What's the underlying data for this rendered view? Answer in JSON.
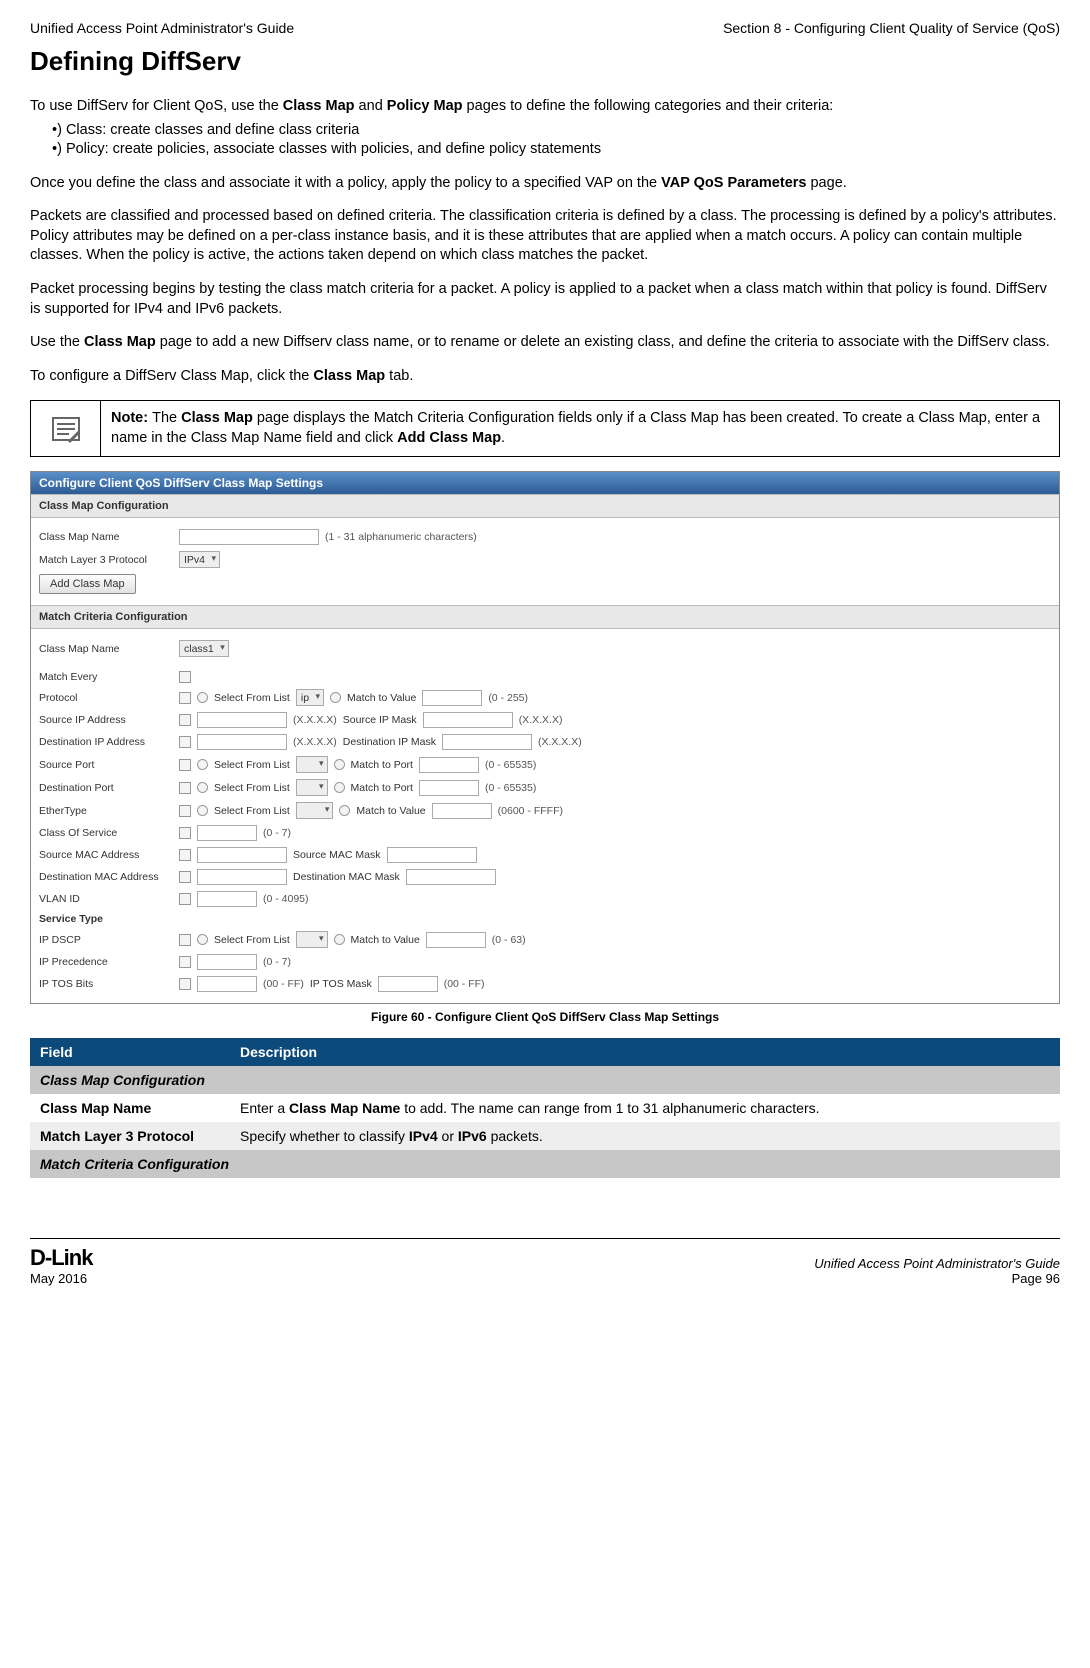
{
  "header": {
    "left": "Unified Access Point Administrator's Guide",
    "right": "Section 8 - Configuring Client Quality of Service (QoS)"
  },
  "title": "Defining DiffServ",
  "paragraphs": {
    "p1a": "To use DiffServ for Client QoS, use the ",
    "p1b": "Class Map",
    "p1c": " and ",
    "p1d": "Policy Map",
    "p1e": " pages to define the following categories and their criteria:",
    "bullet1": "Class: create classes and define class criteria",
    "bullet2": "Policy: create policies, associate classes with policies, and define policy statements",
    "p2a": "Once you define the class and associate it with a policy, apply the policy to a specified VAP on the ",
    "p2b": "VAP QoS Parameters",
    "p2c": " page.",
    "p3": "Packets are classified and processed based on defined criteria. The classification criteria is defined by a class. The processing is defined by a policy's attributes. Policy attributes may be defined on a per-class instance basis, and it is these attributes that are applied when a match occurs. A policy can contain multiple classes. When the policy is active, the actions taken depend on which class matches the packet.",
    "p4": "Packet processing begins by testing the class match criteria for a packet. A policy is applied to a packet when a class match within that policy is found. DiffServ is supported for IPv4 and IPv6 packets.",
    "p5a": "Use the ",
    "p5b": "Class Map",
    "p5c": " page to add a new Diffserv class name, or to rename or delete an existing class, and define the criteria to associate with the DiffServ class.",
    "p6a": "To configure a DiffServ Class Map, click the ",
    "p6b": "Class Map",
    "p6c": " tab."
  },
  "note": {
    "prefix": "Note: ",
    "a": "The ",
    "b": "Class Map",
    "c": " page displays the Match Criteria Configuration fields only if a Class Map has been created. To create a Class Map, enter a name in the Class Map Name field and click ",
    "d": "Add Class Map",
    "e": "."
  },
  "ui": {
    "title": "Configure Client QoS DiffServ Class Map Settings",
    "sect1": "Class Map Configuration",
    "classMapNameLabel": "Class Map Name",
    "matchLayer3Label": "Match Layer 3 Protocol",
    "matchLayer3Value": "IPv4",
    "charHint": "(1 - 31 alphanumeric characters)",
    "addBtn": "Add Class Map",
    "sect2": "Match Criteria Configuration",
    "classMapName2Label": "Class Map Name",
    "classMapName2Value": "class1",
    "rows": {
      "matchEvery": "Match Every",
      "protocol": "Protocol",
      "srcIP": "Source IP Address",
      "dstIP": "Destination IP Address",
      "srcPort": "Source Port",
      "dstPort": "Destination Port",
      "etherType": "EtherType",
      "cos": "Class Of Service",
      "srcMac": "Source MAC Address",
      "dstMac": "Destination MAC Address",
      "vlan": "VLAN ID",
      "serviceType": "Service Type",
      "ipDscp": "IP DSCP",
      "ipPrec": "IP Precedence",
      "ipTos": "IP TOS Bits"
    },
    "labels": {
      "selectFromList": "Select From List",
      "matchToValue": "Match to Value",
      "matchToPort": "Match to Port",
      "srcIpMask": "Source IP Mask",
      "dstIpMask": "Destination IP Mask",
      "srcMacMask": "Source MAC Mask",
      "dstMacMask": "Destination MAC Mask",
      "ipTosMask": "IP TOS Mask",
      "ipProto": "ip"
    },
    "ranges": {
      "r0_255": "(0 - 255)",
      "xxxx": "(X.X.X.X)",
      "r0_65535": "(0 - 65535)",
      "ether": "(0600 - FFFF)",
      "r0_7": "(0 - 7)",
      "r0_4095": "(0 - 4095)",
      "r0_63": "(0 - 63)",
      "r00_ff": "(00 - FF)"
    }
  },
  "figcaption": "Figure 60 - Configure Client QoS DiffServ Class Map Settings",
  "table": {
    "thField": "Field",
    "thDesc": "Description",
    "section1": "Class Map Configuration",
    "r1f": "Class Map Name",
    "r1d_a": "Enter a ",
    "r1d_b": "Class Map Name",
    "r1d_c": " to add. The name can range from 1 to 31 alphanumeric characters.",
    "r2f": "Match Layer 3 Protocol",
    "r2d_a": "Specify whether to classify ",
    "r2d_b": "IPv4",
    "r2d_c": " or ",
    "r2d_d": "IPv6",
    "r2d_e": " packets.",
    "section2": "Match Criteria Configuration"
  },
  "footer": {
    "brand": "D-Link",
    "date": "May 2016",
    "guide": "Unified Access Point Administrator's Guide",
    "page": "Page 96"
  }
}
